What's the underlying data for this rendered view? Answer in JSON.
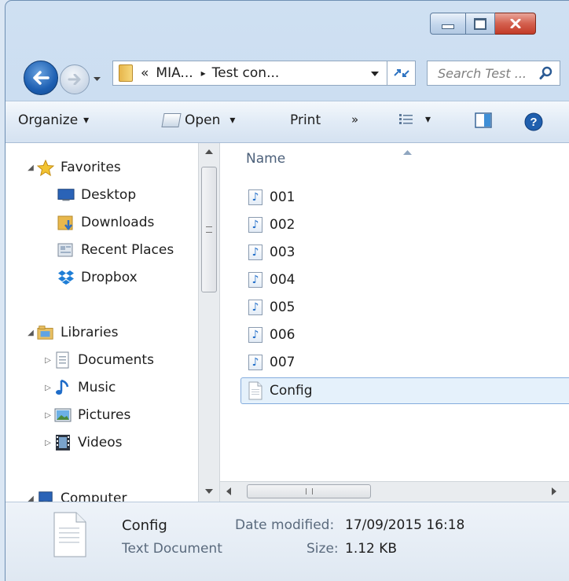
{
  "address_bar": {
    "overflow_glyph": "«",
    "segments": [
      "MIA...",
      "Test con..."
    ],
    "separator": "▸"
  },
  "search": {
    "placeholder": "Search Test ..."
  },
  "toolbar": {
    "organize_label": "Organize",
    "open_label": "Open",
    "print_label": "Print",
    "more_glyph": "»",
    "dropdown_glyph": "▾"
  },
  "navigation": {
    "favorites": {
      "label": "Favorites",
      "items": [
        {
          "label": "Desktop",
          "icon": "desktop-icon"
        },
        {
          "label": "Downloads",
          "icon": "downloads-folder-icon"
        },
        {
          "label": "Recent Places",
          "icon": "recent-places-icon"
        },
        {
          "label": "Dropbox",
          "icon": "dropbox-icon"
        }
      ]
    },
    "libraries": {
      "label": "Libraries",
      "items": [
        {
          "label": "Documents",
          "icon": "documents-library-icon"
        },
        {
          "label": "Music",
          "icon": "music-library-icon"
        },
        {
          "label": "Pictures",
          "icon": "pictures-library-icon"
        },
        {
          "label": "Videos",
          "icon": "videos-library-icon"
        }
      ]
    },
    "computer": {
      "label": "Computer"
    }
  },
  "file_list": {
    "column_name": "Name",
    "files": [
      {
        "name": "001",
        "icon": "music-file-icon"
      },
      {
        "name": "002",
        "icon": "music-file-icon"
      },
      {
        "name": "003",
        "icon": "music-file-icon"
      },
      {
        "name": "004",
        "icon": "music-file-icon"
      },
      {
        "name": "005",
        "icon": "music-file-icon"
      },
      {
        "name": "006",
        "icon": "music-file-icon"
      },
      {
        "name": "007",
        "icon": "music-file-icon"
      },
      {
        "name": "Config",
        "icon": "text-document-icon",
        "selected": true
      }
    ]
  },
  "details_pane": {
    "file_name": "Config",
    "file_type": "Text Document",
    "date_modified_label": "Date modified:",
    "date_modified_value": "17/09/2015 16:18",
    "size_label": "Size:",
    "size_value": "1.12 KB"
  },
  "colors": {
    "selection_fill": "#e5f1fb",
    "selection_border": "#84acdd",
    "accent_blue": "#1d5fb2",
    "close_red": "#c23b27"
  }
}
